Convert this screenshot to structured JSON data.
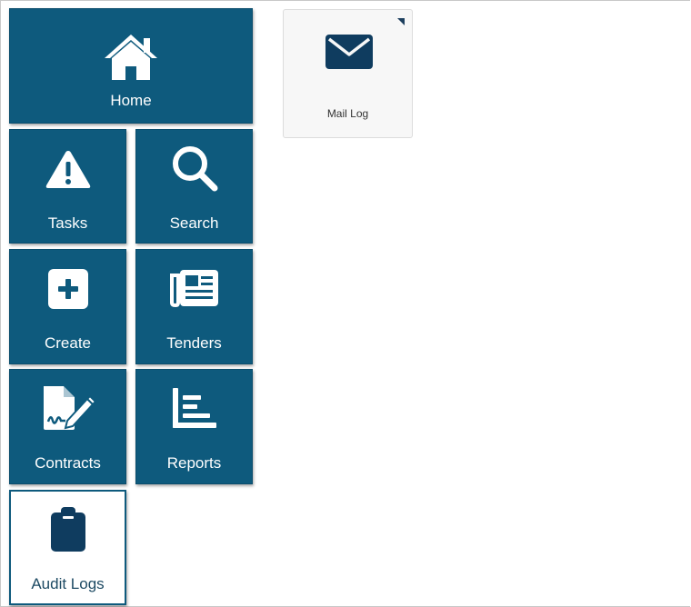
{
  "tiles": {
    "home": {
      "label": "Home",
      "icon": "home-icon"
    },
    "tasks": {
      "label": "Tasks",
      "icon": "warning-icon"
    },
    "search": {
      "label": "Search",
      "icon": "search-icon"
    },
    "create": {
      "label": "Create",
      "icon": "plus-square-icon"
    },
    "tenders": {
      "label": "Tenders",
      "icon": "newspaper-icon"
    },
    "contracts": {
      "label": "Contracts",
      "icon": "file-signature-icon"
    },
    "reports": {
      "label": "Reports",
      "icon": "bar-chart-icon"
    },
    "audit_logs": {
      "label": "Audit Logs",
      "icon": "clipboard-icon"
    }
  },
  "cards": {
    "mail_log": {
      "label": "Mail Log",
      "icon": "envelope-icon"
    }
  },
  "colors": {
    "tile_background": "#0e5a7d",
    "tile_text": "#ffffff",
    "card_background": "#f7f7f7",
    "icon_dark": "#0f3c5f"
  }
}
